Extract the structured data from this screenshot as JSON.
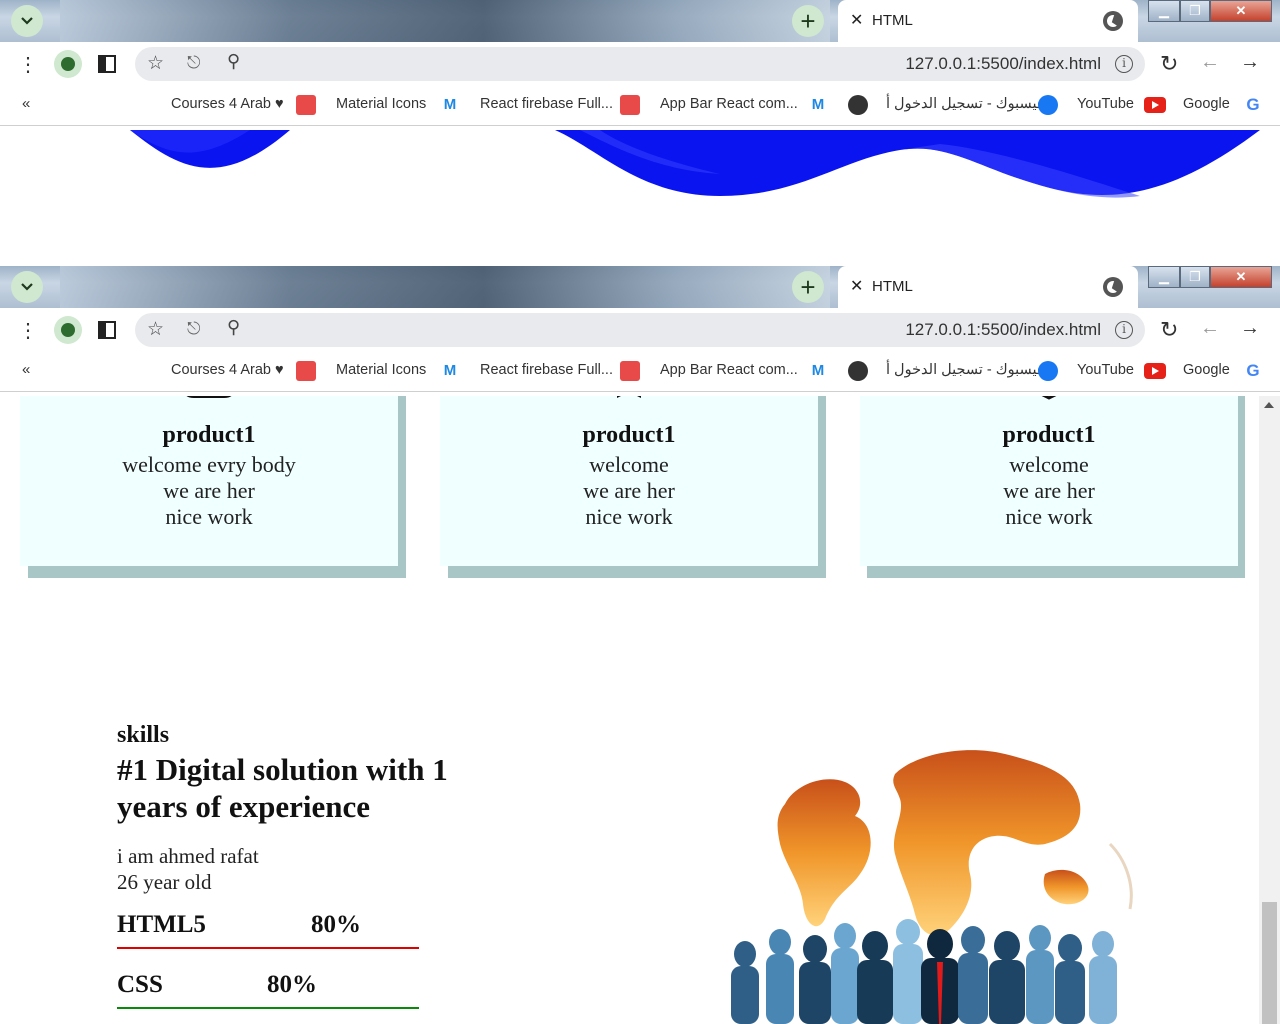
{
  "browser": {
    "tab_title": "HTML",
    "url": "127.0.0.1:5500/index.html",
    "new_tab_symbol": "+",
    "close_symbol": "✕",
    "bookmarks_overflow": "«",
    "bookmarks": [
      {
        "label": "Courses 4 Arab ♥",
        "icon": "red-logo-icon"
      },
      {
        "label": "Material Icons",
        "icon": "mui-icon"
      },
      {
        "label": "React firebase Full...",
        "icon": "red-logo-icon"
      },
      {
        "label": "App Bar React com...",
        "icon": "mui-icon"
      },
      {
        "label": "",
        "icon": "globe-icon"
      },
      {
        "label": "فيسبوك - تسجيل الدخول أ...",
        "icon": "facebook-icon"
      },
      {
        "label": "YouTube",
        "icon": "youtube-icon"
      },
      {
        "label": "Google",
        "icon": "google-icon"
      }
    ]
  },
  "colors": {
    "wave": "#0a14f0",
    "card_bg": "#f0ffff",
    "card_shadow": "#a9c6c6",
    "html_bar": "#e00000",
    "css_bar": "#0a8a0a"
  },
  "cards": [
    {
      "title": "product1",
      "lines": [
        "welcome evry body",
        "we are her",
        "nice work"
      ]
    },
    {
      "title": "product1",
      "lines": [
        "welcome",
        "we are her",
        "nice work"
      ]
    },
    {
      "title": "product1",
      "lines": [
        "welcome",
        "we are her",
        "nice work"
      ]
    }
  ],
  "skills": {
    "kicker": "skills",
    "heading": "#1 Digital solution with 1 years of experience",
    "bio_line1": "i am ahmed rafat",
    "bio_line2": "26 year old",
    "items": [
      {
        "name": "HTML5",
        "percent": "80%"
      },
      {
        "name": "CSS",
        "percent": "80%"
      }
    ]
  }
}
